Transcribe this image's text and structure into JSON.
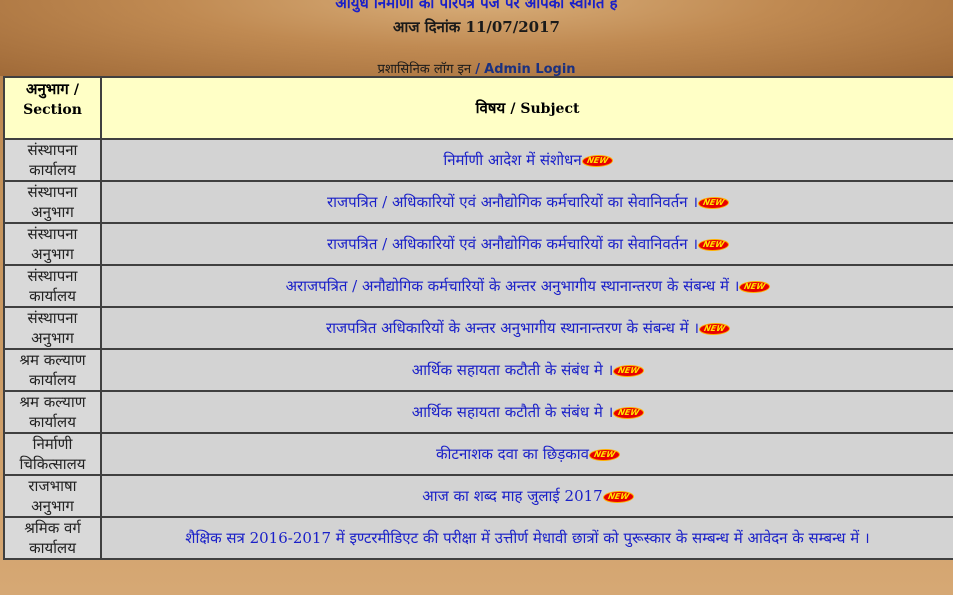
{
  "header": {
    "welcome": "आयुध निर्माणी की परिपत्र पेज पर आपका स्वागत है",
    "date_label": "आज दिनांक",
    "date_value": "11/07/2017",
    "admin_hindi": "प्रशासिनिक लॉग इन",
    "admin_sep": "/",
    "admin_login": "Admin Login"
  },
  "table": {
    "col_section_hi": "अनुभाग",
    "col_section_en": "/ Section",
    "col_subject_hi": "विषय",
    "col_subject_en": "/ Subject",
    "new_badge": "NEW",
    "rows": [
      {
        "section": "संस्थापना कार्यालय",
        "subject": "निर्माणी आदेश में संशोधन"
      },
      {
        "section": "संस्थापना अनुभाग",
        "subject": "राजपत्रित / अधिकारियों एवं अनौद्योगिक कर्मचारियों का सेवानिवर्तन ।"
      },
      {
        "section": "संस्थापना अनुभाग",
        "subject": "राजपत्रित / अधिकारियों एवं अनौद्योगिक कर्मचारियों का सेवानिवर्तन ।"
      },
      {
        "section": "संस्थापना कार्यालय",
        "subject": "अराजपत्रित / अनौद्योगिक कर्मचारियों के अन्तर अनुभागीय स्थानान्तरण के संबन्ध में ।"
      },
      {
        "section": "संस्थापना अनुभाग",
        "subject": "राजपत्रित अधिकारियों के अन्तर अनुभागीय स्थानान्तरण के संबन्ध में ।"
      },
      {
        "section": "श्रम कल्याण कार्यालय",
        "subject": "आर्थिक सहायता कटौती के संबंध मे ।"
      },
      {
        "section": "श्रम कल्याण कार्यालय",
        "subject": "आर्थिक सहायता कटौती के संबंध मे ।"
      },
      {
        "section": "निर्माणी चिकित्सालय",
        "subject": "कीटनाशक दवा का छिड़काव"
      },
      {
        "section": "राजभाषा अनुभाग",
        "subject": "आज का शब्द माह जुलाई 2017"
      },
      {
        "section": "श्रमिक वर्ग कार्यालय",
        "subject": "शैक्षिक सत्र 2016-2017 में इण्टरमीडिएट की परीक्षा में उत्तीर्ण मेधावी छात्रों को पुरूस्कार के सम्बन्ध में आवेदन के सम्बन्ध में ।"
      }
    ]
  }
}
